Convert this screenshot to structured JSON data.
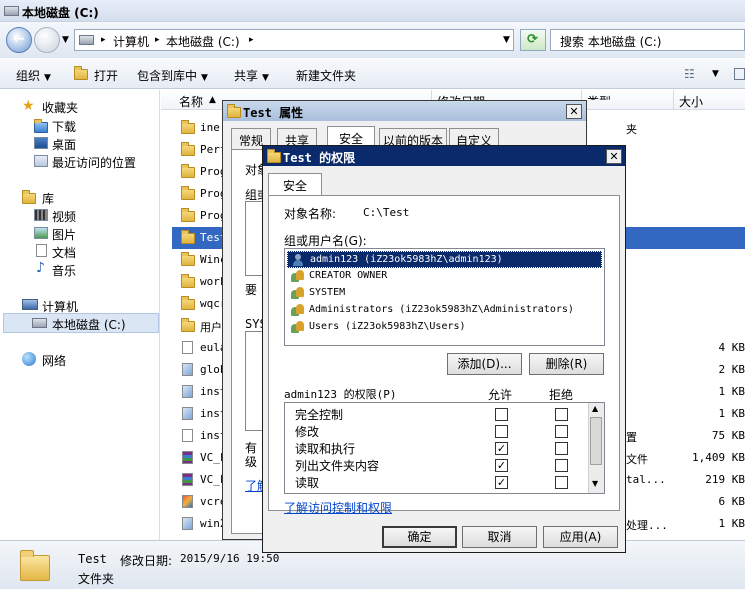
{
  "window": {
    "title": "本地磁盘 (C:)"
  },
  "address": {
    "crumbs": [
      "计算机",
      "本地磁盘 (C:)"
    ],
    "search_placeholder": "搜索 本地磁盘 (C:)"
  },
  "toolbar": {
    "organize": "组织",
    "open": "打开",
    "include": "包含到库中",
    "share": "共享",
    "new_folder": "新建文件夹"
  },
  "sidebar": {
    "favorites": "收藏夹",
    "downloads": "下载",
    "desktop": "桌面",
    "recent": "最近访问的位置",
    "libraries": "库",
    "videos": "视频",
    "pictures": "图片",
    "documents": "文档",
    "music": "音乐",
    "computer": "计算机",
    "local_disk": "本地磁盘 (C:)",
    "network": "网络"
  },
  "columns": {
    "name": "名称",
    "modified": "修改日期",
    "type": "类型",
    "size": "大小"
  },
  "files": [
    {
      "name": "ine",
      "type": "夹",
      "size": ""
    },
    {
      "name": "Perf",
      "type": "",
      "size": ""
    },
    {
      "name": "Prog",
      "type": "",
      "size": ""
    },
    {
      "name": "Prog",
      "type": "",
      "size": ""
    },
    {
      "name": "Prog",
      "type": "",
      "size": ""
    },
    {
      "name": "Test",
      "type": "",
      "size": ""
    },
    {
      "name": "Winc",
      "type": "",
      "size": ""
    },
    {
      "name": "work",
      "type": "",
      "size": ""
    },
    {
      "name": "wqcr",
      "type": "",
      "size": ""
    },
    {
      "name": "用户",
      "type": "",
      "size": ""
    },
    {
      "name": "eula",
      "type": "",
      "size": "4 KB"
    },
    {
      "name": "glob",
      "type": "",
      "size": "2 KB"
    },
    {
      "name": "inst",
      "type": "",
      "size": "1 KB"
    },
    {
      "name": "inst",
      "type": "",
      "size": "1 KB"
    },
    {
      "name": "inst",
      "type": "置",
      "size": "75 KB"
    },
    {
      "name": "VC_F",
      "type": "文件",
      "size": "1,409 KB"
    },
    {
      "name": "VC_F",
      "type": "tal...",
      "size": "219 KB"
    },
    {
      "name": "vcre",
      "type": "",
      "size": "6 KB"
    },
    {
      "name": "win2",
      "type": "处理...",
      "size": "1 KB"
    }
  ],
  "details": {
    "name": "Test",
    "modified_label": "修改日期:",
    "modified_value": "2015/9/16 19:50",
    "kind": "文件夹"
  },
  "props": {
    "title": "Test 属性",
    "tabs": [
      "常规",
      "共享",
      "安全",
      "以前的版本",
      "自定义"
    ],
    "obj_label": "对象",
    "group_label": "组或",
    "edit_short": "要",
    "system_short": "SYS",
    "adv_short1": "有",
    "adv_short2": "级",
    "link_short": "了解"
  },
  "perm": {
    "title": "Test 的权限",
    "tab": "安全",
    "object_label": "对象名称:",
    "object_value": "C:\\Test",
    "groups_label": "组或用户名(G):",
    "users": [
      {
        "name": "admin123 (iZ23ok5983hZ\\admin123)",
        "kind": "user",
        "selected": true
      },
      {
        "name": "CREATOR OWNER",
        "kind": "group",
        "selected": false
      },
      {
        "name": "SYSTEM",
        "kind": "group",
        "selected": false
      },
      {
        "name": "Administrators (iZ23ok5983hZ\\Administrators)",
        "kind": "group",
        "selected": false
      },
      {
        "name": "Users (iZ23ok5983hZ\\Users)",
        "kind": "group",
        "selected": false
      }
    ],
    "add_button": "添加(D)...",
    "remove_button": "删除(R)",
    "perm_label": "admin123 的权限(P)",
    "allow_label": "允许",
    "deny_label": "拒绝",
    "permissions": [
      {
        "name": "完全控制",
        "allow": false,
        "deny": false
      },
      {
        "name": "修改",
        "allow": false,
        "deny": false
      },
      {
        "name": "读取和执行",
        "allow": true,
        "deny": false
      },
      {
        "name": "列出文件夹内容",
        "allow": true,
        "deny": false
      },
      {
        "name": "读取",
        "allow": true,
        "deny": false
      }
    ],
    "learn_link": "了解访问控制和权限",
    "ok": "确定",
    "cancel": "取消",
    "apply": "应用(A)"
  }
}
